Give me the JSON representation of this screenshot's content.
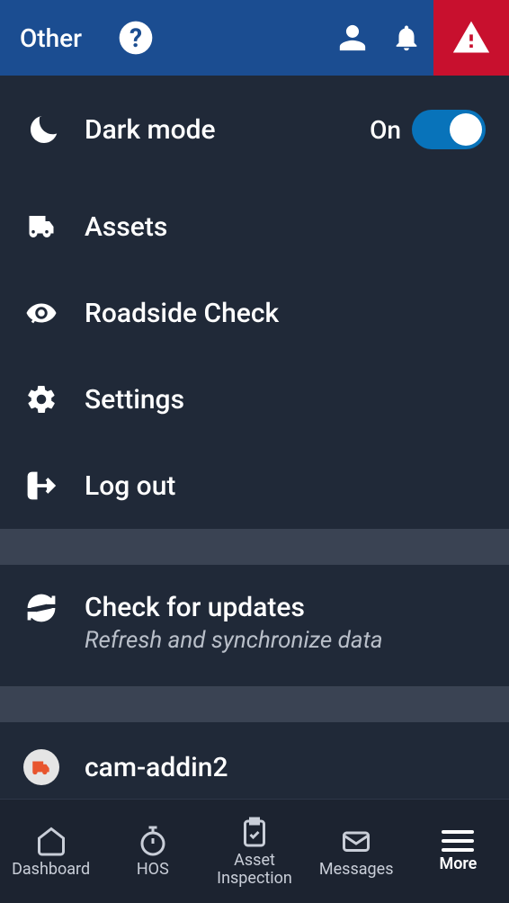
{
  "header": {
    "title": "Other"
  },
  "menu": {
    "dark_mode": {
      "label": "Dark mode",
      "state": "On"
    },
    "assets": {
      "label": "Assets"
    },
    "roadside": {
      "label": "Roadside Check"
    },
    "settings": {
      "label": "Settings"
    },
    "logout": {
      "label": "Log out"
    }
  },
  "updates": {
    "title": "Check for updates",
    "subtitle": "Refresh and synchronize data"
  },
  "addin": {
    "name": "cam-addin2"
  },
  "nav": {
    "dashboard": "Dashboard",
    "hos": "HOS",
    "asset_inspection": "Asset Inspection",
    "messages": "Messages",
    "more": "More"
  }
}
